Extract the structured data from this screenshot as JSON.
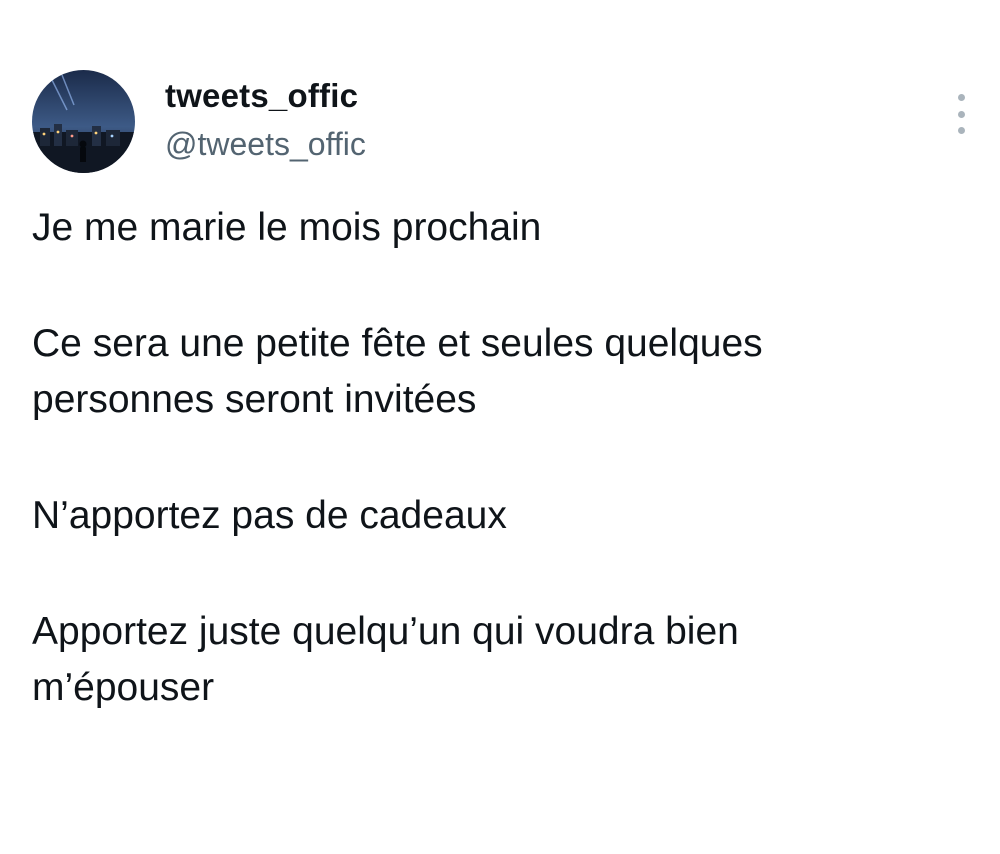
{
  "author": {
    "display_name": "tweets_offic",
    "handle": "@tweets_offic",
    "avatar_icon": "avatar-night-city-image"
  },
  "menu": {
    "icon": "more-options-icon"
  },
  "tweet": {
    "paragraphs": [
      "Je me marie le mois prochain",
      "Ce sera une petite fête et seules quelques\npersonnes seront invitées",
      "N’apportez pas de cadeaux",
      "Apportez juste quelqu’un qui voudra bien\nm’épouser"
    ]
  },
  "colors": {
    "text_primary": "#0f1419",
    "text_secondary": "#536471",
    "menu_dots": "#aab4bc"
  }
}
